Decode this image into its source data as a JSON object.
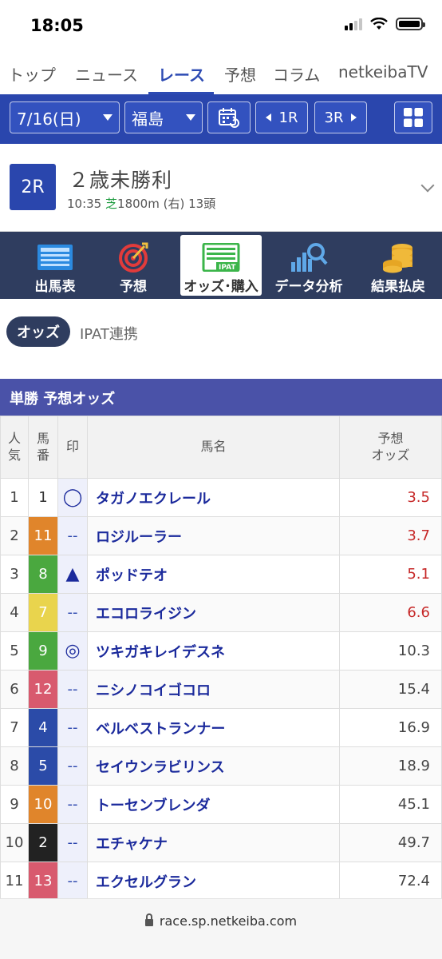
{
  "status_bar": {
    "time": "18:05"
  },
  "top_nav": {
    "tabs": [
      "トップ",
      "ニュース",
      "レース",
      "予想",
      "コラム",
      "netkeibaTV"
    ],
    "active": "レース"
  },
  "selector": {
    "date": "7/16(日)",
    "venue": "福島",
    "prev_race": "1R",
    "next_race": "3R"
  },
  "race": {
    "number": "2R",
    "title": "２歳未勝利",
    "time": "10:35",
    "surface": "芝",
    "distance": "1800m",
    "direction": "(右)",
    "runners": "13頭"
  },
  "menu": [
    {
      "label": "出馬表",
      "icon": "list-icon"
    },
    {
      "label": "予想",
      "icon": "target-icon"
    },
    {
      "label": "オッズ･購入",
      "icon": "ipat-icon",
      "active": true
    },
    {
      "label": "データ分析",
      "icon": "chart-magnify-icon"
    },
    {
      "label": "結果払戻",
      "icon": "coins-icon"
    }
  ],
  "sub_tabs": {
    "active": "オッズ",
    "other": "IPAT連携"
  },
  "section_title": "単勝  予想オッズ",
  "table": {
    "headers": {
      "rank_1": "人",
      "rank_2": "気",
      "num_1": "馬",
      "num_2": "番",
      "mark": "印",
      "name": "馬名",
      "odds_1": "予想",
      "odds_2": "オッズ"
    },
    "rows": [
      {
        "rank": "1",
        "num": "1",
        "mark": "◯",
        "name": "タガノエクレール",
        "odds": "3.5",
        "hot": true,
        "waku_bg": "#ffffff",
        "waku_fg": "#333333"
      },
      {
        "rank": "2",
        "num": "11",
        "mark": "--",
        "name": "ロジルーラー",
        "odds": "3.7",
        "hot": true,
        "waku_bg": "#e0852b",
        "waku_fg": "#ffffff"
      },
      {
        "rank": "3",
        "num": "8",
        "mark": "▲",
        "name": "ポッドテオ",
        "odds": "5.1",
        "hot": true,
        "waku_bg": "#4aa83f",
        "waku_fg": "#ffffff"
      },
      {
        "rank": "4",
        "num": "7",
        "mark": "--",
        "name": "エコロライジン",
        "odds": "6.6",
        "hot": true,
        "waku_bg": "#e9d44d",
        "waku_fg": "#ffffff"
      },
      {
        "rank": "5",
        "num": "9",
        "mark": "◎",
        "name": "ツキガキレイデスネ",
        "odds": "10.3",
        "hot": false,
        "waku_bg": "#4aa83f",
        "waku_fg": "#ffffff"
      },
      {
        "rank": "6",
        "num": "12",
        "mark": "--",
        "name": "ニシノコイゴコロ",
        "odds": "15.4",
        "hot": false,
        "waku_bg": "#d85a6e",
        "waku_fg": "#ffffff"
      },
      {
        "rank": "7",
        "num": "4",
        "mark": "--",
        "name": "ベルベストランナー",
        "odds": "16.9",
        "hot": false,
        "waku_bg": "#2b4ba8",
        "waku_fg": "#ffffff"
      },
      {
        "rank": "8",
        "num": "5",
        "mark": "--",
        "name": "セイウンラビリンス",
        "odds": "18.9",
        "hot": false,
        "waku_bg": "#2b4ba8",
        "waku_fg": "#ffffff"
      },
      {
        "rank": "9",
        "num": "10",
        "mark": "--",
        "name": "トーセンブレンダ",
        "odds": "45.1",
        "hot": false,
        "waku_bg": "#e0852b",
        "waku_fg": "#ffffff"
      },
      {
        "rank": "10",
        "num": "2",
        "mark": "--",
        "name": "エチャケナ",
        "odds": "49.7",
        "hot": false,
        "waku_bg": "#222222",
        "waku_fg": "#ffffff"
      },
      {
        "rank": "11",
        "num": "13",
        "mark": "--",
        "name": "エクセルグラン",
        "odds": "72.4",
        "hot": false,
        "waku_bg": "#d85a6e",
        "waku_fg": "#ffffff"
      }
    ]
  },
  "url_bar": {
    "url": "race.sp.netkeiba.com"
  }
}
